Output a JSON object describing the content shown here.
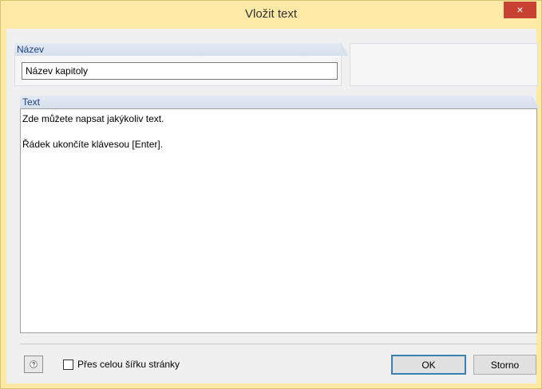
{
  "window": {
    "title": "Vložit text",
    "close_label": "×"
  },
  "name_section": {
    "label": "Název",
    "value": "Název kapitoly"
  },
  "text_section": {
    "label": "Text",
    "value": "Zde můžete napsat jakýkoliv text.\n\nŘádek ukončíte klávesou [Enter]."
  },
  "footer": {
    "full_width_label": "Přes celou šířku stránky",
    "full_width_checked": false,
    "ok_label": "OK",
    "cancel_label": "Storno",
    "help_icon": "help-icon"
  },
  "colors": {
    "title_bar": "#ffe9a6",
    "close_button": "#c84031",
    "section_label": "#16407f",
    "ok_border": "#3c7fb1"
  }
}
